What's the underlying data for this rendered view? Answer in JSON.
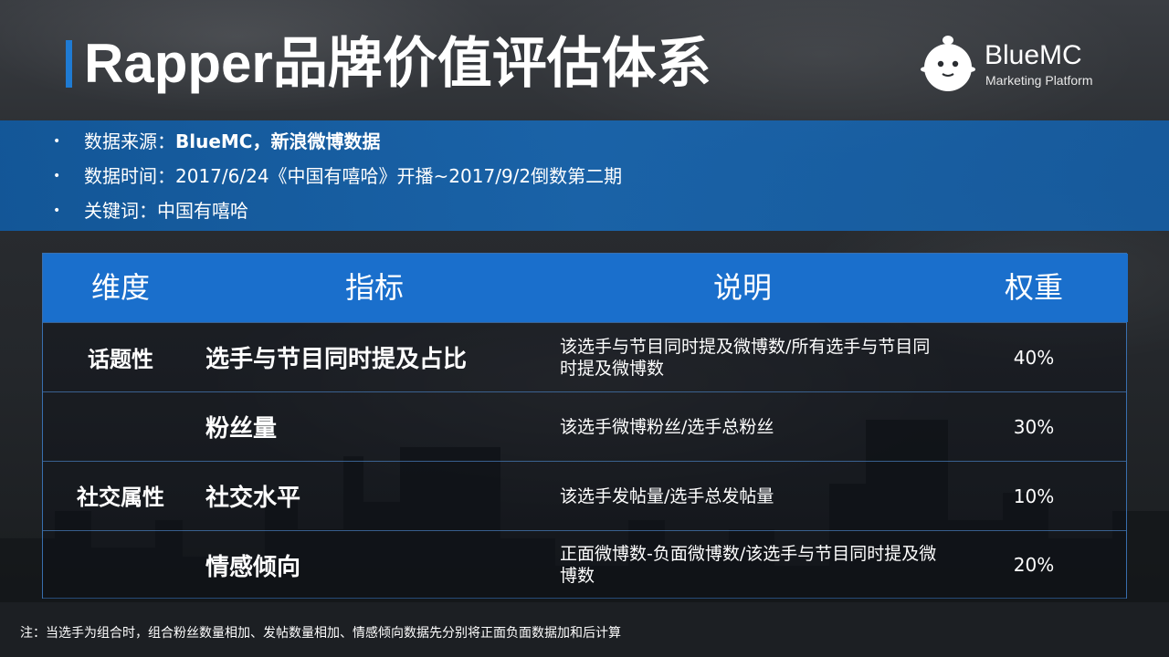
{
  "slide": {
    "title": "Rapper品牌价值评估体系",
    "logo": {
      "brand": "BlueMC",
      "tagline": "Marketing Platform"
    }
  },
  "info": {
    "items": [
      {
        "bullet": "•",
        "label": "数据来源：",
        "value": "BlueMC，新浪微博数据"
      },
      {
        "bullet": "•",
        "label": "数据时间：",
        "value": "2017/6/24《中国有嘻哈》开播~2017/9/2倒数第二期"
      },
      {
        "bullet": "•",
        "label": "关键词：",
        "value": "中国有嘻哈"
      }
    ]
  },
  "table": {
    "headers": {
      "dimension": "维度",
      "indicator": "指标",
      "description": "说明",
      "weight": "权重"
    },
    "dimensions": {
      "topic": "话题性",
      "social": "社交属性"
    },
    "rows": [
      {
        "indicator": "选手与节目同时提及占比",
        "description": "该选手与节目同时提及微博数/所有选手与节目同时提及微博数",
        "weight": "40%"
      },
      {
        "indicator": "粉丝量",
        "description": "该选手微博粉丝/选手总粉丝",
        "weight": "30%"
      },
      {
        "indicator": "社交水平",
        "description": "该选手发帖量/选手总发帖量",
        "weight": "10%"
      },
      {
        "indicator": "情感倾向",
        "description": "正面微博数-负面微博数/该选手与节目同时提及微博数",
        "weight": "20%"
      }
    ]
  },
  "footnote": "注：当选手为组合时，组合粉丝数量相加、发帖数量相加、情感倾向数据先分别将正面负面数据加和后计算",
  "colors": {
    "accent": "#1f7bd3",
    "header_blue": "#1a6fcc",
    "band_blue": "#1868b4"
  }
}
